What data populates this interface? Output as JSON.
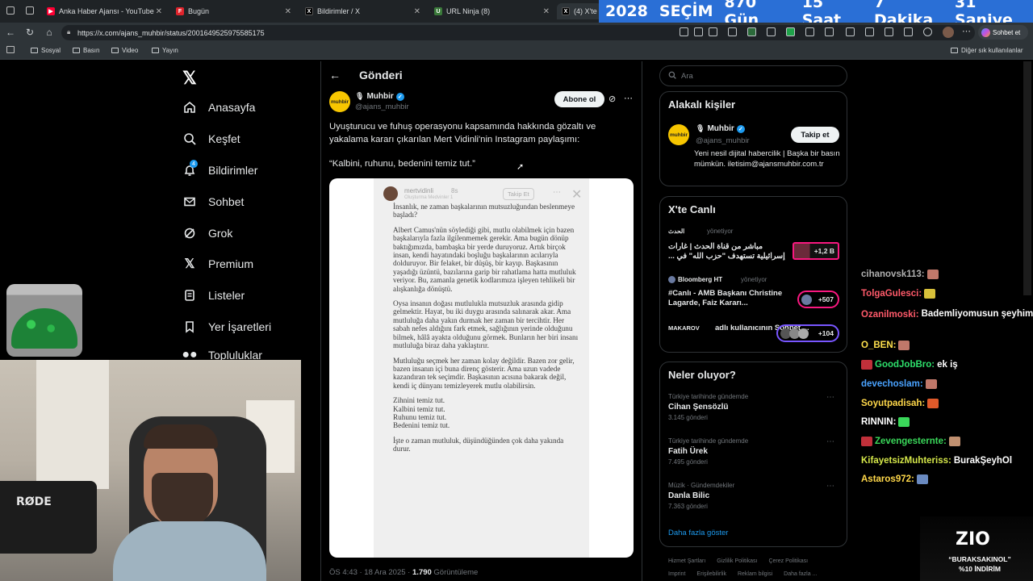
{
  "browser": {
    "tabs": [
      {
        "title": "Anka Haber Ajansı - YouTube",
        "icon": "youtube-icon",
        "color": "#ff0033"
      },
      {
        "title": "Bugün",
        "icon": "bugun-icon",
        "color": "#e0242c"
      },
      {
        "title": "Bildirimler / X",
        "icon": "x-icon",
        "color": "#000000"
      },
      {
        "title": "URL Ninja (8)",
        "icon": "url-ninja-icon",
        "color": "#3a7a3a"
      },
      {
        "title": "(4) X'te",
        "icon": "x-icon",
        "color": "#000000"
      }
    ],
    "countdown": {
      "year": "2028",
      "label": "SEÇİM",
      "days": "870 Gün",
      "hours": "15 Saat",
      "minutes": "7 Dakika",
      "seconds": "31 Saniye"
    },
    "url": "https://x.com/ajans_muhbir/status/2001649525975585175",
    "chat_button": "Sohbet et",
    "bookmarks": [
      "Sosyal",
      "Basın",
      "Video",
      "Yayın"
    ],
    "other_bookmarks": "Diğer sık kullanılanlar"
  },
  "nav": {
    "items": [
      {
        "label": "Anasayfa",
        "icon": "home-icon"
      },
      {
        "label": "Keşfet",
        "icon": "search-icon"
      },
      {
        "label": "Bildirimler",
        "icon": "bell-icon",
        "badge": "4"
      },
      {
        "label": "Sohbet",
        "icon": "mail-icon"
      },
      {
        "label": "Grok",
        "icon": "grok-icon"
      },
      {
        "label": "Premium",
        "icon": "x-logo-icon"
      },
      {
        "label": "Listeler",
        "icon": "list-icon"
      },
      {
        "label": "Yer İşaretleri",
        "icon": "bookmark-icon"
      },
      {
        "label": "Topluluklar",
        "icon": "communities-icon"
      }
    ]
  },
  "post": {
    "header": "Gönderi",
    "author_name": "Muhbir",
    "author_handle": "@ajans_muhbir",
    "avatar_text": "muhbir",
    "subscribe_label": "Abone ol",
    "text": "Uyuşturucu ve fuhuş operasyonu kapsamında hakkında gözaltı ve yakalama kararı çıkarılan Mert Vidinli'nin Instagram paylaşımı:",
    "quote": "“Kalbini, ruhunu, bedenini temiz tut.”",
    "meta_time": "ÖS 4:43 · 18 Ara 2025 · ",
    "views_count": "1.790",
    "views_label": " Görüntüleme"
  },
  "story": {
    "username": "mertvidinli",
    "time": "8s",
    "subtitle": "Oluşturma Medvinler 1",
    "follow_label": "Takip Et",
    "paragraphs": [
      "İnsanlık, ne zaman başkalarının mutsuzluğundan beslenmeye başladı?",
      "Albert Camus'nün söylediği gibi, mutlu olabilmek için bazen başkalarıyla fazla ilgilenmemek gerekir. Ama bugün dönüp baktığımızda, bambaşka bir yerde duruyoruz. Artık birçok insan, kendi hayatındaki boşluğu başkalarının acılarıyla dolduruyor. Bir felaket, bir düşüş, bir kayıp. Başkasının yaşadığı üzüntü, bazılarına garip bir rahatlama hatta mutluluk veriyor. Bu, zamanla genetik kodlarımıza işleyen tehlikeli bir alışkanlığa dönüştü.",
      "Oysa insanın doğası mutlulukla mutsuzluk arasında gidip gelmektir. Hayat, bu iki duygu arasında salınarak akar. Ama mutluluğa daha yakın durmak her zaman bir tercihtir. Her sabah nefes aldığını fark etmek, sağlığının yerinde olduğunu bilmek, hâlâ ayakta olduğunu görmek. Bunların her biri insanı mutluluğa biraz daha yaklaştırır.",
      "Mutluluğu seçmek her zaman kolay değildir. Bazen zor gelir, bazen insanın içi buna direnç gösterir. Ama uzun vadede kazandıran tek seçimdir. Başkasının acısına bakarak değil, kendi iç dünyanı temizleyerek mutlu olabilirsin.",
      "Zihnini temiz tut.\nKalbini temiz tut.\nRuhunu temiz tut.\nBedenini temiz tut.",
      "İşte o zaman mutluluk, düşündüğünden çok daha yakında durur."
    ]
  },
  "search": {
    "placeholder": "Ara"
  },
  "related": {
    "title": "Alakalı kişiler",
    "name": "Muhbir",
    "handle": "@ajans_muhbir",
    "follow_label": "Takip et",
    "bio": "Yeni nesil dijital habercilik | Başka bir basın mümkün. iletisim@ajansmuhbir.com.tr"
  },
  "live": {
    "title": "X'te Canlı",
    "items": [
      {
        "host": "الحدث",
        "role": "yönetiyor",
        "text": "مباشر من قناة الحدث | غارات إسرائيلية تستهدف \"حزب الله\" في ...",
        "count": "+1,2 B"
      },
      {
        "host": "Bloomberg HT",
        "role": "yönetiyor",
        "text": "#Canlı - AMB Başkanı Christine Lagarde, Faiz Kararı...",
        "count": "+507"
      },
      {
        "host": "MAKAROV",
        "role": "",
        "text": "adlı kullanıcının Sohbet ...",
        "count": "+104"
      }
    ]
  },
  "trends": {
    "title": "Neler oluyor?",
    "items": [
      {
        "context": "Türkiye tarihinde gündemde",
        "name": "Cihan Şensözlü",
        "posts": "3.145 gönderi"
      },
      {
        "context": "Türkiye tarihinde gündemde",
        "name": "Fatih Ürek",
        "posts": "7.495 gönderi"
      },
      {
        "context": "Müzik · Gündemdekiler",
        "name": "Danla Bilic",
        "posts": "7.363 gönderi"
      }
    ],
    "show_more": "Daha fazla göster"
  },
  "footer": {
    "links": [
      "Hizmet Şartları",
      "Gizlilik Politikası",
      "Çerez Politikası"
    ],
    "links2": [
      "Imprint",
      "Erişilebilirlik",
      "Reklam bilgisi",
      "Daha fazla ..."
    ]
  },
  "chat": [
    {
      "user": "cihanovsk113:",
      "msg": "",
      "color": "#b0b0b0"
    },
    {
      "user": "TolgaGulesci:",
      "msg": "",
      "color": "#ff5a6a"
    },
    {
      "user": "Ozanilmoski:",
      "msg": "Bademliyomusun şeyhim",
      "color": "#ff5a6a"
    },
    {
      "user": "O_BEN:",
      "msg": "",
      "color": "#ffe14d"
    },
    {
      "user": "GoodJobBro:",
      "msg": "ek iş",
      "color": "#2ee06c"
    },
    {
      "user": "devechoslam:",
      "msg": "",
      "color": "#4aa3ff"
    },
    {
      "user": "Soyutpadisah:",
      "msg": "",
      "color": "#ffd84a"
    },
    {
      "user": "RINNIN:",
      "msg": "",
      "color": "#ffffff"
    },
    {
      "user": "Zevengesternte:",
      "msg": "",
      "color": "#3ad85a"
    },
    {
      "user": "KifayetsizMuhteriss:",
      "msg": "BurakŞeyhOl",
      "color": "#d6e84a"
    },
    {
      "user": "Astaros972:",
      "msg": "",
      "color": "#ffd84a"
    }
  ],
  "sponsor": {
    "brand": "ZIO",
    "code": "“BURAKSAKINOL”",
    "discount": "%10 İNDİRİM"
  },
  "webcam": {
    "mic_brand": "RØDE"
  }
}
